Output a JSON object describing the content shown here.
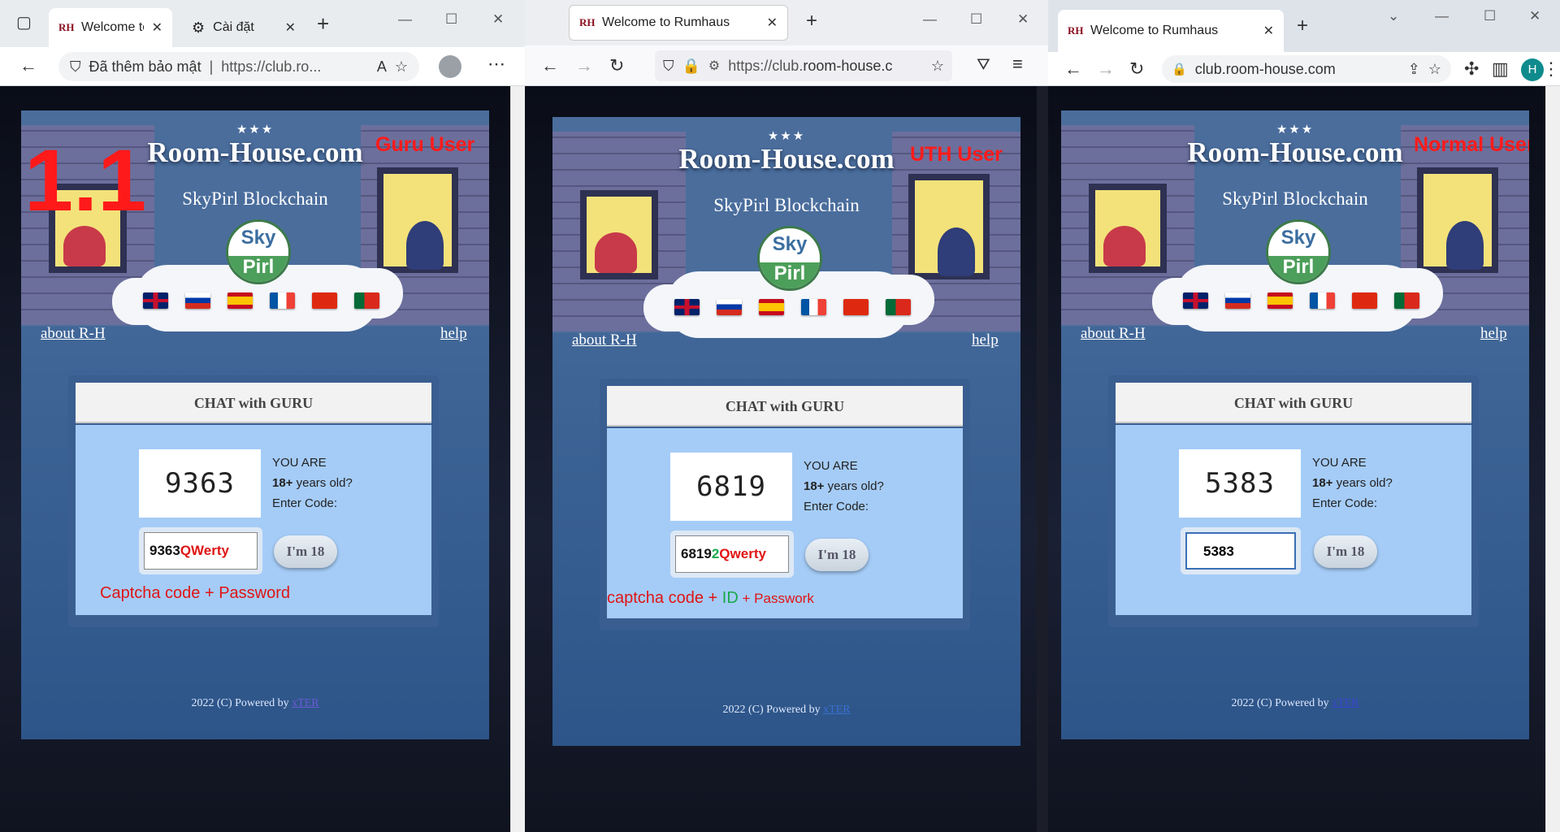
{
  "site": {
    "stars": "★★★",
    "brand": "Room-House.com",
    "subtitle": "SkyPirl Blockchain",
    "logo_top": "Sky",
    "logo_bottom": "Pirl",
    "about": "about R-H",
    "help": "help",
    "card_title": "CHAT with GURU",
    "you_are": "YOU ARE",
    "age_bold": "18+",
    "age_rest": " years old?",
    "enter_code": "Enter Code:",
    "button": "I'm 18",
    "footer_prefix": "2022 (C) Powered by ",
    "footer_link": "xTER",
    "favicon": "RH"
  },
  "window1": {
    "tab1": "Welcome to",
    "tab2": "Cài đặt",
    "security": "Đã thêm bảo mật",
    "url": "https://club.ro...",
    "overlay_number": "1.1",
    "role": "Guru User",
    "captcha": "9363",
    "input_part1": "9363",
    "input_part2": "QWerty",
    "note": "Captcha code + Password"
  },
  "window2": {
    "tab1": "Welcome to Rumhaus",
    "url_prefix": "https://club.",
    "url_domain": "room-house.c",
    "role": "UTH User",
    "captcha": "6819",
    "input_part1": "6819",
    "input_part2": "2",
    "input_part3": "Qwerty",
    "note_part1": "captcha code + ",
    "note_part2": "ID",
    "note_part3": " + Passwork"
  },
  "window3": {
    "tab1": "Welcome to Rumhaus",
    "url": "club.room-house.com",
    "avatar": "H",
    "role": "Normal User",
    "captcha": "5383",
    "input_value": "5383"
  }
}
